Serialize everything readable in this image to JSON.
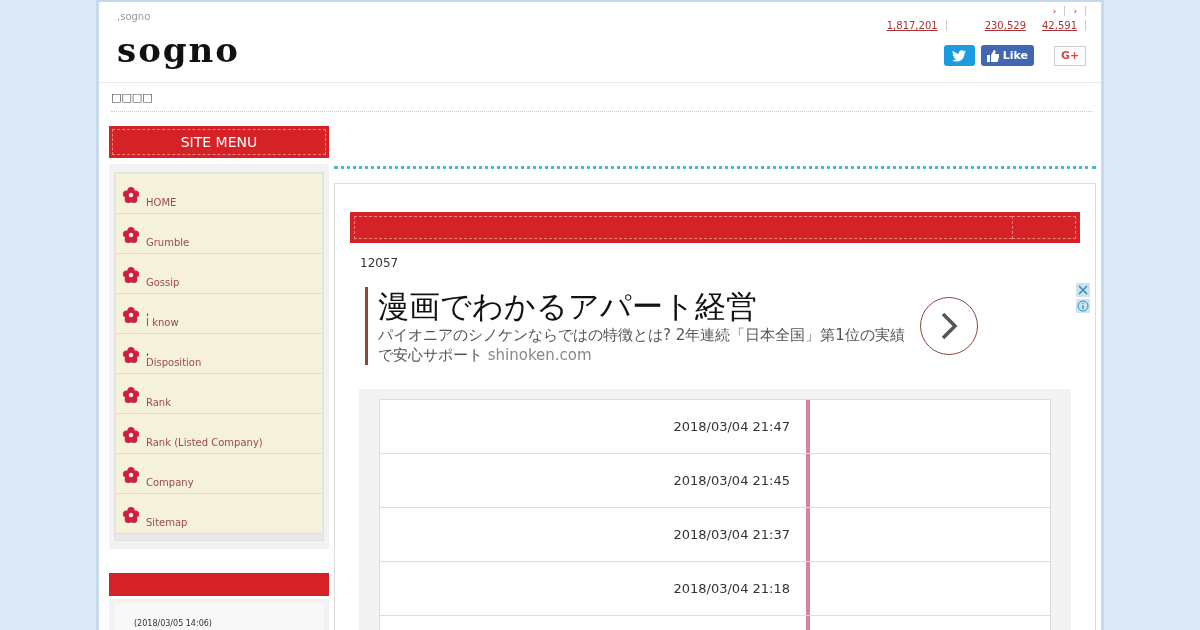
{
  "header": {
    "tagline": ",sogno",
    "logo": "sogno",
    "nav_marks": [
      "›",
      "›"
    ],
    "counts": [
      "1,817,201",
      "230,529",
      "42,591"
    ],
    "share": [
      {
        "kind": "twitter"
      },
      {
        "kind": "like",
        "label": "Like"
      },
      {
        "kind": "gplus",
        "label": "G+"
      }
    ]
  },
  "nav": {
    "label": "□□□□"
  },
  "sidebar": {
    "menu_title": "SITE MENU",
    "items": [
      {
        "label": "HOME"
      },
      {
        "label": "Grumble"
      },
      {
        "label": "Gossip"
      },
      {
        "note": ",",
        "label": "I know"
      },
      {
        "note": ",",
        "label": "Disposition"
      },
      {
        "label": "Rank"
      },
      {
        "label": "Rank (Listed Company)"
      },
      {
        "label": "Company"
      },
      {
        "label": "Sitemap"
      }
    ],
    "recent": {
      "date": "(2018/03/05 14:06)"
    }
  },
  "main": {
    "count": "12057",
    "ad": {
      "headline": "漫画でわかるアパート経営",
      "description": "パイオニアのシノケンならではの特徴とは? 2年連続「日本全国」第1位の実績で安心サポート",
      "domain": "shinoken.com"
    },
    "rows": [
      {
        "date": "2018/03/04 21:47"
      },
      {
        "date": "2018/03/04 21:45"
      },
      {
        "date": "2018/03/04 21:37"
      },
      {
        "date": "2018/03/04 21:18"
      },
      {}
    ]
  }
}
